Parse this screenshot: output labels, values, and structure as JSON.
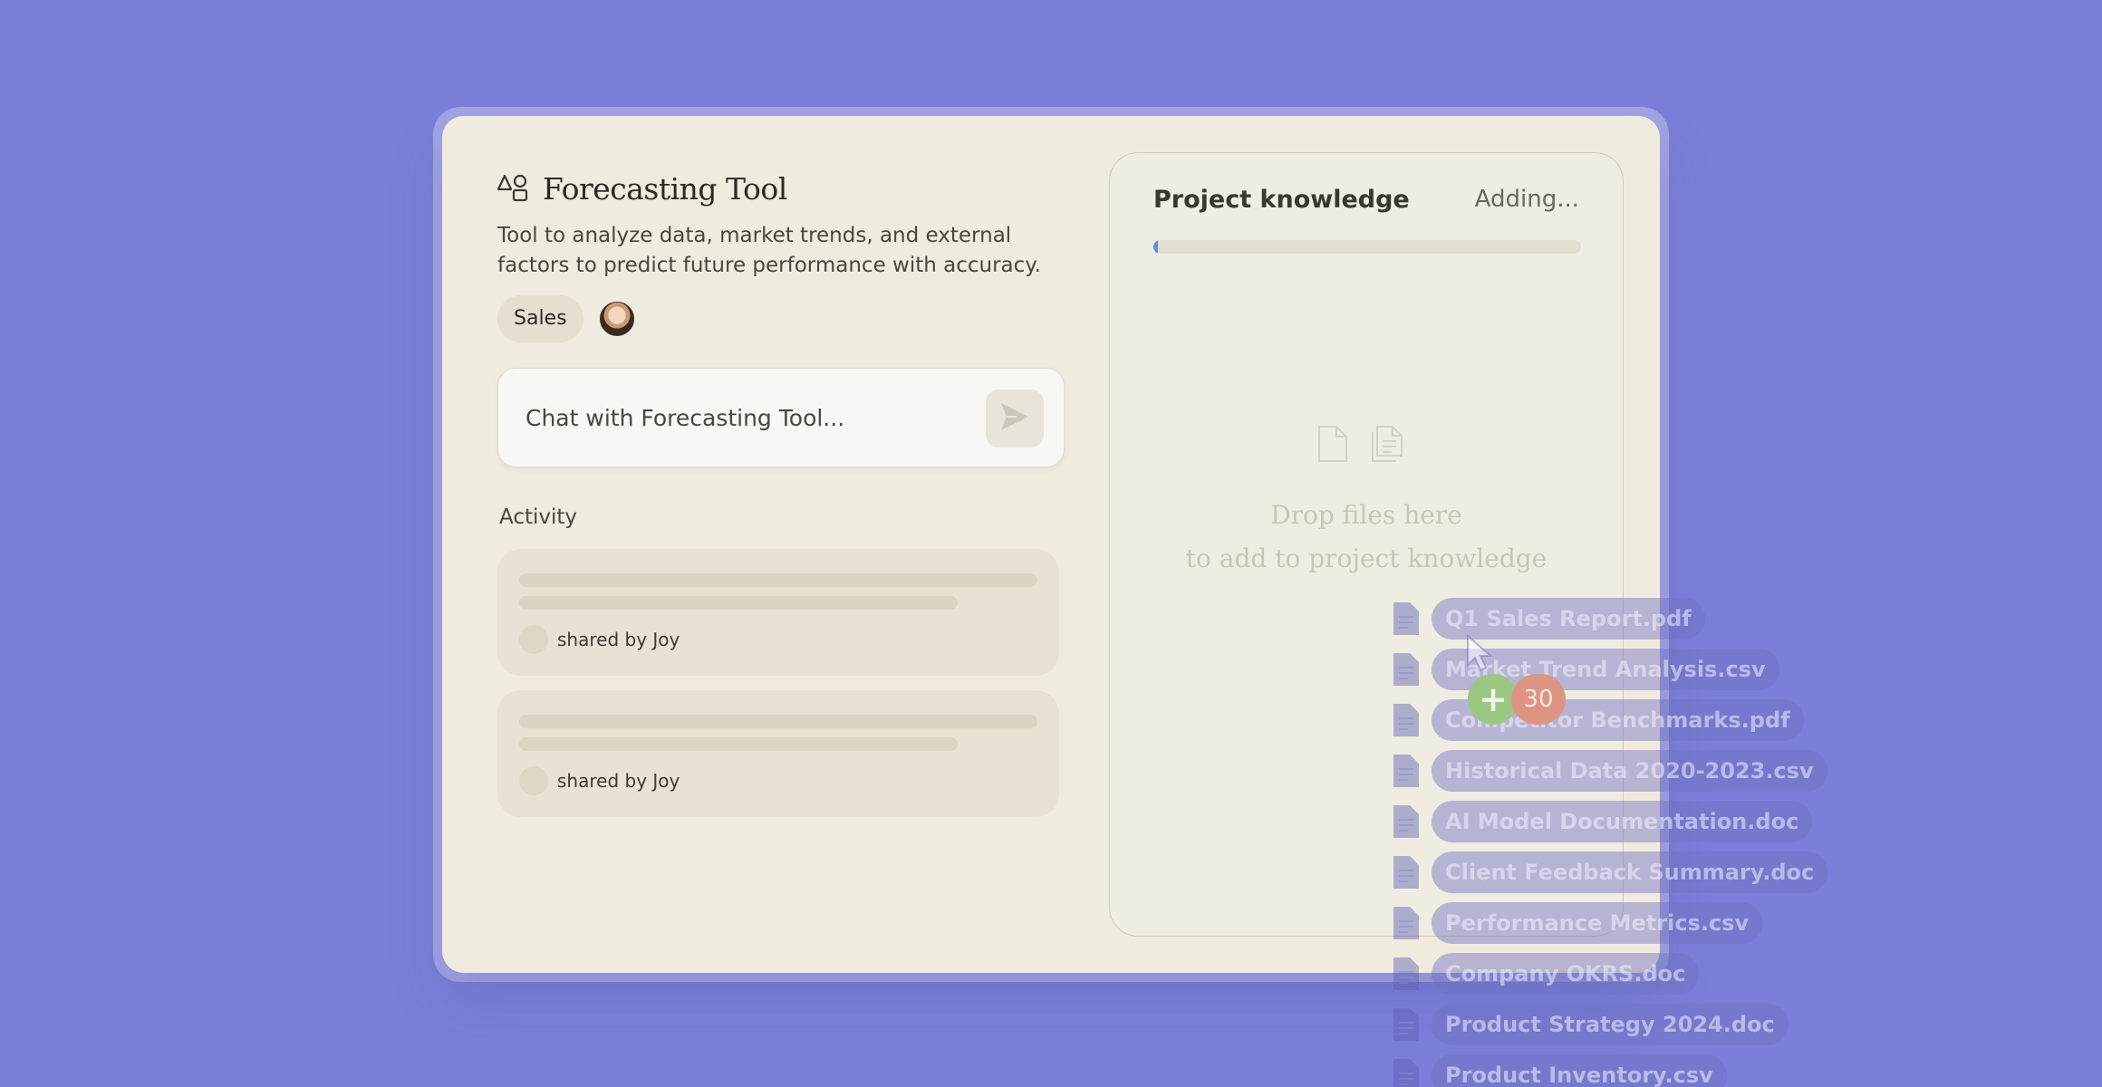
{
  "project": {
    "icon": "shapes-icon",
    "title": "Forecasting Tool",
    "description": "Tool to analyze data, market trends, and external factors to predict future performance with accuracy.",
    "tag": "Sales"
  },
  "chat": {
    "placeholder": "Chat with Forecasting Tool...",
    "send_icon": "send-icon"
  },
  "activity": {
    "label": "Activity",
    "items": [
      {
        "shared_by": "shared by Joy"
      },
      {
        "shared_by": "shared by Joy"
      }
    ]
  },
  "knowledge": {
    "title": "Project knowledge",
    "status": "Adding...",
    "progress": 0.01,
    "drop_line1": "Drop files here",
    "drop_line2": "to add to project knowledge"
  },
  "files": [
    "Q1 Sales Report.pdf",
    "Market Trend Analysis.csv",
    "Competitor Benchmarks.pdf",
    "Historical Data 2020-2023.csv",
    "AI Model Documentation.doc",
    "Client Feedback Summary.doc",
    "Performance Metrics.csv",
    "Company OKRS.doc",
    "Product Strategy 2024.doc",
    "Product Inventory.csv"
  ],
  "drag": {
    "plus": "+",
    "count": "30"
  },
  "colors": {
    "background": "#7b7fd9",
    "card": "#f0ebdf",
    "progress": "#5a8fd6",
    "plus_badge": "#9ac882",
    "count_badge": "#dd9483"
  }
}
